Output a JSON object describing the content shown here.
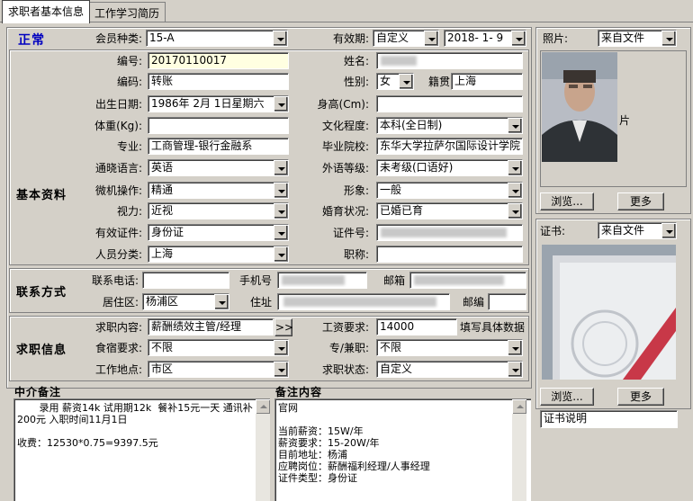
{
  "tabs": [
    {
      "label": "求职者基本信息"
    },
    {
      "label": "工作学习简历"
    }
  ],
  "status": "正常",
  "top": {
    "member_type_label": "会员种类:",
    "member_type_value": "15-A",
    "validity_label": "有效期:",
    "validity_mode": "自定义",
    "validity_date": "2018- 1- 9"
  },
  "sections": {
    "basic": "基本资料",
    "contact": "联系方式",
    "job": "求职信息"
  },
  "basic": {
    "number_label": "编号:",
    "number_value": "20170110017",
    "name_label": "姓名:",
    "code_label": "编码:",
    "code_value": "转账",
    "gender_label": "性别:",
    "gender_value": "女",
    "origin_label": "籍贯",
    "origin_value": "上海",
    "birth_label": "出生日期:",
    "birth_value": "1986年 2月 1日星期六",
    "height_label": "身高(Cm):",
    "weight_label": "体重(Kg):",
    "education_label": "文化程度:",
    "education_value": "本科(全日制)",
    "major_label": "专业:",
    "major_value": "工商管理-银行金融系",
    "school_label": "毕业院校:",
    "school_value": "东华大学拉萨尔国际设计学院",
    "language_label": "通晓语言:",
    "language_value": "英语",
    "language_level_label": "外语等级:",
    "language_level_value": "未考级(口语好)",
    "computer_label": "微机操作:",
    "computer_value": "精通",
    "appearance_label": "形象:",
    "appearance_value": "一般",
    "vision_label": "视力:",
    "vision_value": "近视",
    "marital_label": "婚育状况:",
    "marital_value": "已婚已育",
    "id_type_label": "有效证件:",
    "id_type_value": "身份证",
    "id_number_label": "证件号:",
    "category_label": "人员分类:",
    "category_value": "上海",
    "title_label": "职称:"
  },
  "contact": {
    "phone_label": "联系电话:",
    "mobile_label": "手机号",
    "email_label": "邮箱",
    "district_label": "居住区:",
    "district_value": "杨浦区",
    "address_label": "住址",
    "zip_label": "邮编"
  },
  "job": {
    "content_label": "求职内容:",
    "content_value": "薪酬绩效主管/经理",
    "more_button": ">>",
    "salary_label": "工资要求:",
    "salary_value": "14000",
    "salary_hint": "填写具体数据",
    "meal_label": "食宿要求:",
    "meal_value": "不限",
    "parttime_label": "专/兼职:",
    "parttime_value": "不限",
    "location_label": "工作地点:",
    "location_value": "市区",
    "state_label": "求职状态:",
    "state_value": "自定义"
  },
  "agency_note": {
    "title": "中介备注",
    "text": "       录用 薪资14k 试用期12k  餐补15元一天 通讯补200元 入职时间11月1日\n\n收费：12530*0.75=9397.5元"
  },
  "remarks": {
    "title": "备注内容",
    "text": "官网\n\n当前薪资：15W/年\n薪资要求：15-20W/年\n目前地址：杨浦\n应聘岗位：薪酬福利经理/人事经理\n证件类型：身份证"
  },
  "photo": {
    "label": "照片:",
    "source": "来自文件",
    "caption": "片",
    "browse_button": "浏览...",
    "more_button": "更多"
  },
  "certificate": {
    "label": "证书:",
    "source": "来自文件",
    "browse_button": "浏览...",
    "more_button": "更多",
    "description": "证书说明"
  }
}
